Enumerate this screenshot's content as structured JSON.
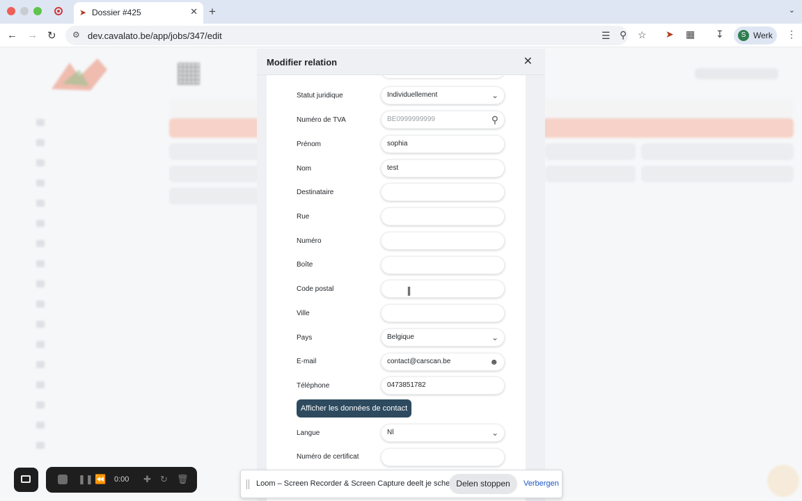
{
  "browser": {
    "tab_title": "Dossier #425",
    "url": "dev.cavalato.be/app/jobs/347/edit",
    "profile_initial": "S",
    "profile_name": "Werk"
  },
  "modal": {
    "title": "Modifier relation",
    "fields": [
      {
        "label": "Statut juridique",
        "value": "Individuellement",
        "type": "select"
      },
      {
        "label": "Numéro de TVA",
        "placeholder": "BE0999999999",
        "type": "search"
      },
      {
        "label": "Prénom",
        "value": "sophia",
        "type": "text"
      },
      {
        "label": "Nom",
        "value": "test",
        "type": "text"
      },
      {
        "label": "Destinataire",
        "value": "",
        "type": "text"
      },
      {
        "label": "Rue",
        "value": "",
        "type": "text"
      },
      {
        "label": "Numéro",
        "value": "",
        "type": "text"
      },
      {
        "label": "Boîte",
        "value": "",
        "type": "text"
      },
      {
        "label": "Code postal",
        "value": "",
        "type": "text"
      },
      {
        "label": "Ville",
        "value": "",
        "type": "text"
      },
      {
        "label": "Pays",
        "value": "Belgique",
        "type": "select"
      },
      {
        "label": "E-mail",
        "value": "contact@carscan.be",
        "type": "email"
      },
      {
        "label": "Téléphone",
        "value": "0473851782",
        "type": "text"
      }
    ],
    "contact_button": "Afficher les données de contact",
    "extra_fields": [
      {
        "label": "Langue",
        "value": "Nl",
        "type": "select"
      },
      {
        "label": "Numéro de certificat",
        "value": "",
        "type": "text"
      }
    ]
  },
  "loom": {
    "time": "0:00",
    "share_text": "Loom – Screen Recorder & Screen Capture deelt je scherm.",
    "stop_label": "Delen stoppen",
    "hide_label": "Verbergen"
  },
  "colors": {
    "accent_button": "#2d4a5f",
    "tabbar": "#dfe6f3",
    "brand": "#b03a1b"
  }
}
